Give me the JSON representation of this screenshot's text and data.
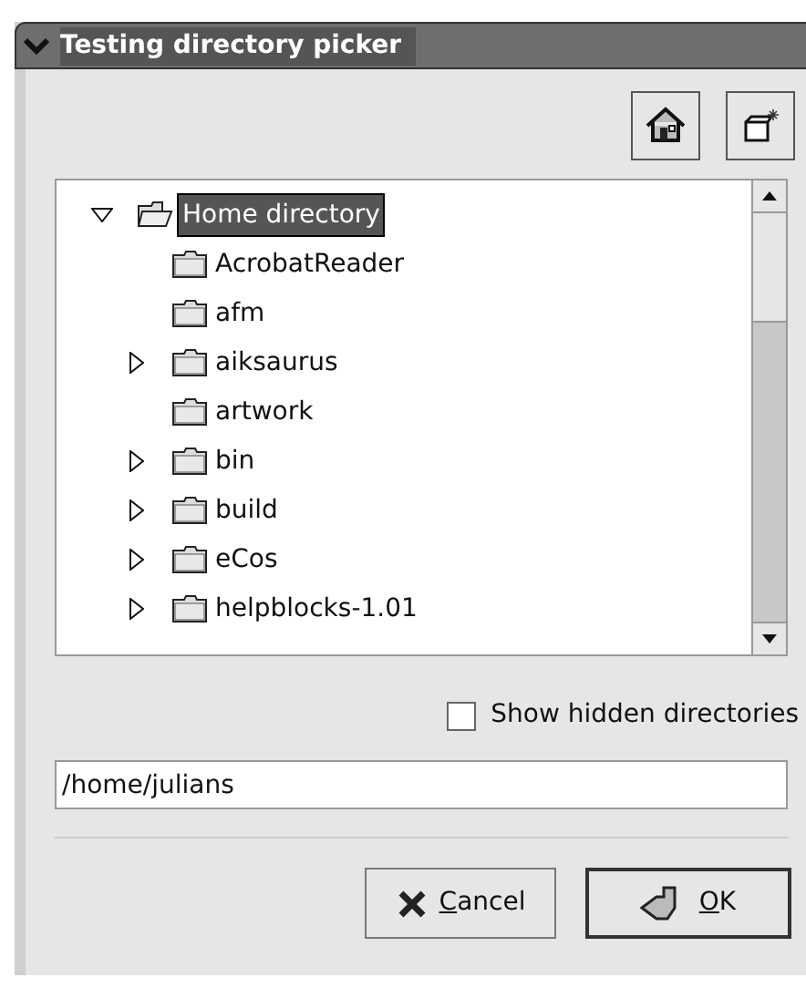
{
  "window": {
    "title": "Testing directory picker"
  },
  "tree": {
    "root": {
      "label": "Home directory",
      "expanded": true,
      "selected": true,
      "children": [
        {
          "label": "AcrobatReader",
          "has_children": false
        },
        {
          "label": "afm",
          "has_children": false
        },
        {
          "label": "aiksaurus",
          "has_children": true
        },
        {
          "label": "artwork",
          "has_children": false
        },
        {
          "label": "bin",
          "has_children": true
        },
        {
          "label": "build",
          "has_children": true
        },
        {
          "label": "eCos",
          "has_children": true
        },
        {
          "label": "helpblocks-1.01",
          "has_children": true
        }
      ]
    }
  },
  "show_hidden": {
    "label": "Show hidden directories",
    "checked": false
  },
  "path_field": {
    "value": "/home/julians"
  },
  "buttons": [
    {
      "kind": "cancel",
      "label": "Cancel"
    },
    {
      "kind": "ok",
      "label": "OK"
    }
  ]
}
